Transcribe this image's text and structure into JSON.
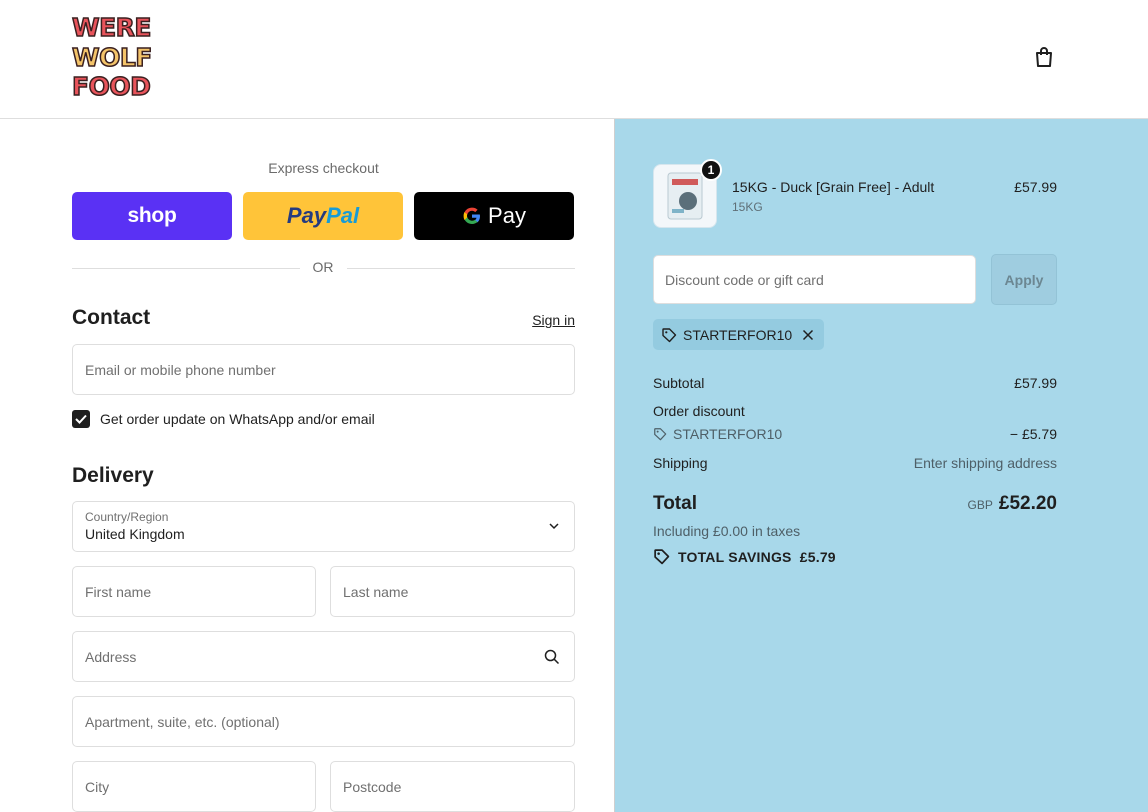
{
  "brand": {
    "logo_lines": [
      "WERE",
      "WOLF",
      "FOOD"
    ]
  },
  "header": {
    "cart_icon": "shopping-bag-icon"
  },
  "express": {
    "label": "Express checkout",
    "shop_label": "shop",
    "paypal_label_1": "Pay",
    "paypal_label_2": "Pal",
    "gpay_label": "Pay",
    "or_label": "OR"
  },
  "contact": {
    "title": "Contact",
    "sign_in": "Sign in",
    "email_placeholder": "Email or mobile phone number",
    "whatsapp_label": "Get order update on WhatsApp and/or email",
    "whatsapp_checked": true
  },
  "delivery": {
    "title": "Delivery",
    "country_label": "Country/Region",
    "country_value": "United Kingdom",
    "first_name_placeholder": "First name",
    "last_name_placeholder": "Last name",
    "address_placeholder": "Address",
    "apartment_placeholder": "Apartment, suite, etc. (optional)",
    "city_placeholder": "City",
    "postcode_placeholder": "Postcode"
  },
  "cart": {
    "item": {
      "name": "15KG - Duck [Grain Free] - Adult",
      "variant": "15KG",
      "price": "£57.99",
      "quantity": "1"
    },
    "discount_placeholder": "Discount code or gift card",
    "apply_label": "Apply",
    "applied_code": "STARTERFOR10"
  },
  "summary": {
    "subtotal_label": "Subtotal",
    "subtotal_value": "£57.99",
    "order_discount_label": "Order discount",
    "discount_code": "STARTERFOR10",
    "discount_value": "− £5.79",
    "shipping_label": "Shipping",
    "shipping_value": "Enter shipping address",
    "total_label": "Total",
    "total_currency": "GBP",
    "total_value": "£52.20",
    "tax_note": "Including £0.00 in taxes",
    "savings": "TOTAL SAVINGS  £5.79"
  },
  "colors": {
    "shop_purple": "#5a31f4",
    "paypal_yellow": "#ffc439",
    "summary_bg": "#a8d8ea"
  }
}
